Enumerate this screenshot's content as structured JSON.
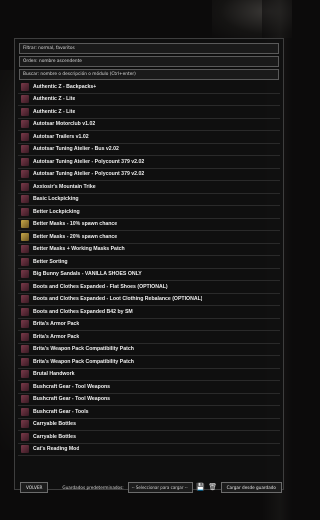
{
  "filters": {
    "filter_sort": "Filtrar: normal, favoritos",
    "order_sort": "Orden: nombre ascendente",
    "search_placeholder": "Buscar: nombre o descripción o módulo (Ctrl+enter)"
  },
  "mods": [
    {
      "name": "Authentic Z - Backpacks+",
      "icon": "pink"
    },
    {
      "name": "Authentic Z - Lite",
      "icon": "pink"
    },
    {
      "name": "Authentic Z - Lite",
      "icon": "pink"
    },
    {
      "name": "Autotsar Motorclub v1.02",
      "icon": "pink"
    },
    {
      "name": "Autotsar Trailers v1.02",
      "icon": "pink"
    },
    {
      "name": "Autotsar Tuning Atelier - Bus v2.02",
      "icon": "pink"
    },
    {
      "name": "Autotsar Tuning Atelier - Polycount 379 v2.02",
      "icon": "pink"
    },
    {
      "name": "Autotsar Tuning Atelier - Polycount 379 v2.02",
      "icon": "pink"
    },
    {
      "name": "Axxiosir's Mountain Trike",
      "icon": "pink"
    },
    {
      "name": "Basic Lockpicking",
      "icon": "pink"
    },
    {
      "name": "Better Lockpicking",
      "icon": "pink"
    },
    {
      "name": "Better Masks - 10% spawn chance",
      "icon": "yellow"
    },
    {
      "name": "Better Masks - 20% spawn chance",
      "icon": "yellow"
    },
    {
      "name": "Better Masks + Working Masks Patch",
      "icon": "pink"
    },
    {
      "name": "Better Sorting",
      "icon": "pink"
    },
    {
      "name": "Big Bunny Sandals - VANILLA SHOES ONLY",
      "icon": "pink"
    },
    {
      "name": "Boots and Clothes Expanded - Flat Shoes (OPTIONAL)",
      "icon": "pink"
    },
    {
      "name": "Boots and Clothes Expanded - Loot Clothing Rebalance (OPTIONAL)",
      "icon": "pink"
    },
    {
      "name": "Boots and Clothes Expanded B42 by SM",
      "icon": "pink"
    },
    {
      "name": "Brita's Armor Pack",
      "icon": "pink"
    },
    {
      "name": "Brita's Armor Pack",
      "icon": "pink"
    },
    {
      "name": "Brita's Weapon Pack Compatibility Patch",
      "icon": "pink"
    },
    {
      "name": "Brita's Weapon Pack Compatibility Patch",
      "icon": "pink"
    },
    {
      "name": "Brutal Handwork",
      "icon": "pink"
    },
    {
      "name": "Bushcraft Gear - Tool Weapons",
      "icon": "pink"
    },
    {
      "name": "Bushcraft Gear - Tool Weapons",
      "icon": "pink"
    },
    {
      "name": "Bushcraft Gear - Tools",
      "icon": "pink"
    },
    {
      "name": "Carryable Bottles",
      "icon": "pink"
    },
    {
      "name": "Carryable Bottles",
      "icon": "pink"
    },
    {
      "name": "Cat's Reading Mod",
      "icon": "pink"
    }
  ],
  "bottom": {
    "back_label": "VOLVER",
    "presets_label": "Guardados predeterminados:",
    "preset_select": "-- Seleccionar para cargar --",
    "load_label": "Cargar desde guardado"
  }
}
